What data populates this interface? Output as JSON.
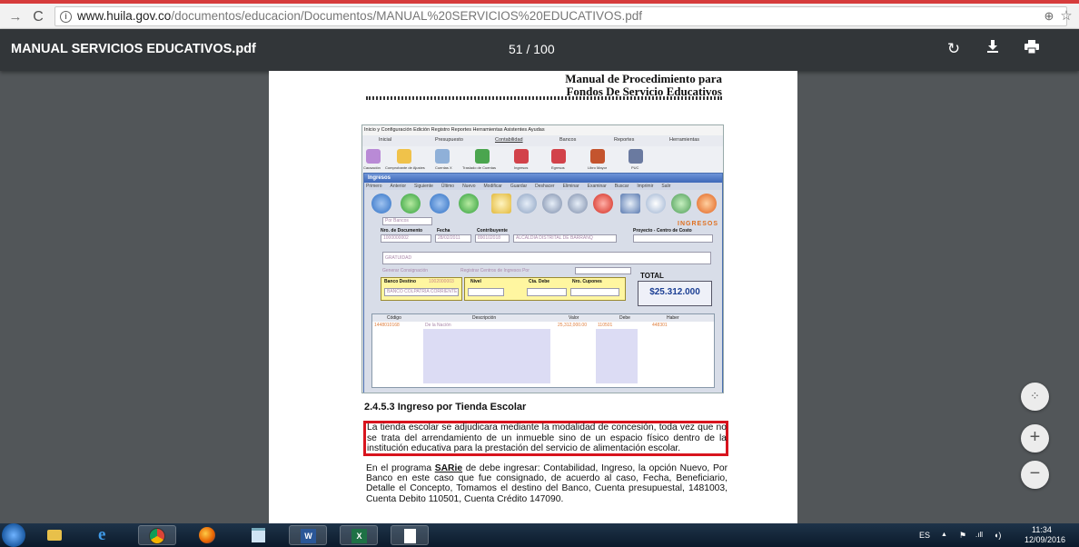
{
  "browser": {
    "url_host": "www.huila.gov.co",
    "url_path": "/documentos/educacion/Documentos/MANUAL%20SERVICIOS%20EDUCATIVOS.pdf",
    "back_icon": "back-arrow-icon",
    "reload_icon": "reload-icon",
    "zoom_icon": "zoom-icon",
    "bookmark_icon": "star-icon"
  },
  "pdf_toolbar": {
    "title": "MANUAL SERVICIOS EDUCATIVOS.pdf",
    "current_page": "51",
    "separator": "/",
    "total_pages": "100"
  },
  "document": {
    "header_line1": "Manual de Procedimiento para",
    "header_line2": "Fondos De Servicio Educativos",
    "embedded_app": {
      "menu": "Inicio y Configuración  Edición  Registro  Reportes  Herramientas  Asistentes  Ayudas",
      "tabs": [
        "Inicial",
        "Presupuesto",
        "Contabilidad",
        "Bancos",
        "Reportes",
        "Herramientas"
      ],
      "icon_labels": [
        "Causación",
        "Comprobante de Ajustes",
        "Cuentas X",
        "Traslado de Cuentas",
        "Ingresos",
        "Egresos",
        "Libro Mayor",
        "PUC"
      ],
      "dialog_title": "Ingresos",
      "dialog_menu": [
        "Primero",
        "Anterior",
        "Siguiente",
        "Último",
        "Nuevo",
        "Modificar",
        "Guardar",
        "Deshacer",
        "Eliminar",
        "Examinar",
        "Buscar",
        "Imprimir",
        "Salir"
      ],
      "brand": "INGRESOS",
      "tipo": "Por Bancos",
      "labels": {
        "nro_documento": "Nro. de Documento",
        "fecha": "Fecha",
        "contribuyente": "Contribuyente",
        "proyecto": "Proyecto - Centro de Costo",
        "banco_destino": "Banco Destino",
        "nivel": "Nivel",
        "cta_debe": "Cta. Debe",
        "nro_cupones": "Nro. Cupones"
      },
      "values": {
        "nro_documento": "1000000002",
        "fecha": "28/02/2011",
        "contribuyente": "890102018",
        "contribuyente_nombre": "ALCALDIA DISTRITAL DE BARRANQ",
        "concepto": "GRATUIDAD",
        "check1": "Generar Consignación",
        "check2": "Registrar Centros de Ingresos Por",
        "banco_codigo": "1002000003",
        "banco_nombre": "BANCO COLPATRIA CORRIENTE"
      },
      "total_label": "TOTAL",
      "total_value": "$25.312.000",
      "grid_headers": [
        "Código",
        "Descripción",
        "Valor",
        "Debe",
        "Haber"
      ],
      "grid_row": [
        "1448010168",
        "De la Nación",
        "25,312,000.00",
        "110501",
        "448301"
      ]
    },
    "section_heading": "2.4.5.3 Ingreso por Tienda Escolar",
    "paragraph1": "La tienda escolar se adjudicara mediante la modalidad de concesión, toda vez que no se trata del arrendamiento de un inmueble sino de un espacio físico dentro de la institución educativa para la prestación del servicio de alimentación escolar.",
    "paragraph2_prefix": "En el programa ",
    "paragraph2_bold": "SARie",
    "paragraph2_rest": " de debe ingresar: Contabilidad, Ingreso, la opción Nuevo, Por Banco en este caso que fue consignado, de acuerdo al caso, Fecha, Beneficiario, Detalle el Concepto, Tomamos el destino del Banco, Cuenta presupuestal, 1481003, Cuenta Debito 110501, Cuenta Crédito 147090."
  },
  "fab": {
    "fit_icon": "fit-to-page-icon",
    "zoom_in": "+",
    "zoom_out": "−"
  },
  "taskbar": {
    "apps": [
      "folder-icon",
      "internet-explorer-icon",
      "chrome-icon",
      "firefox-icon",
      "notepad-icon",
      "word-icon",
      "excel-icon",
      "blank-document-icon"
    ],
    "lang": "ES",
    "time": "11:34",
    "date": "12/09/2016"
  }
}
